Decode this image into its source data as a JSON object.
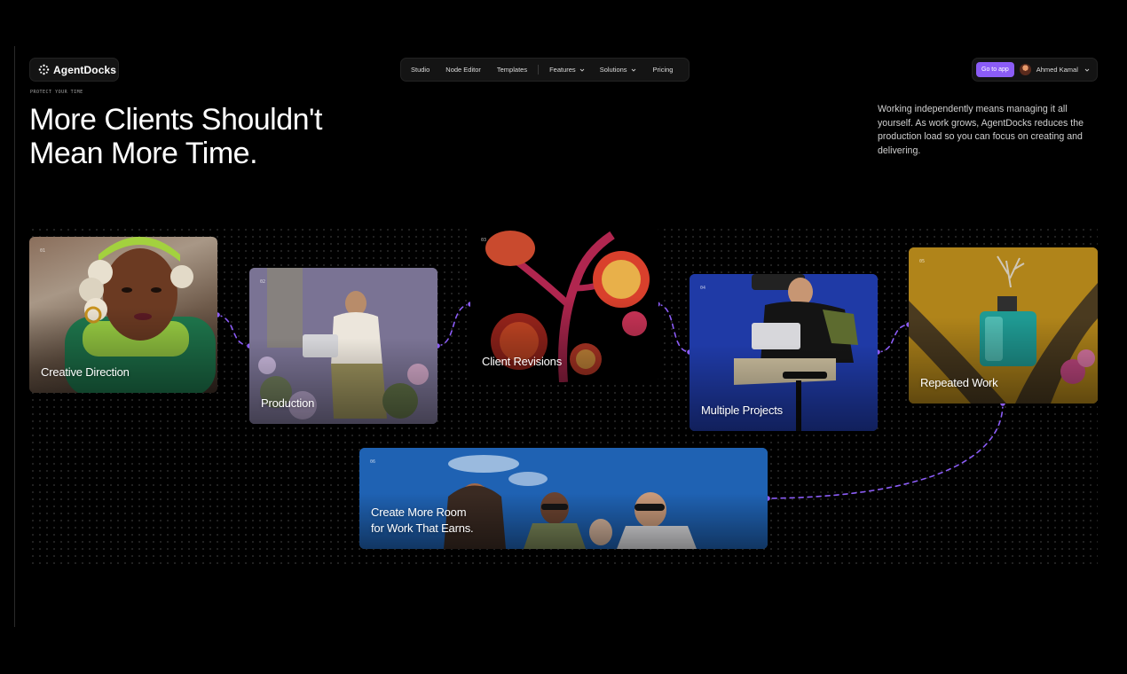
{
  "app": {
    "name": "AgentDocks"
  },
  "nav": {
    "items": [
      {
        "label": "Studio",
        "dropdown": false
      },
      {
        "label": "Node Editor",
        "dropdown": false
      },
      {
        "label": "Templates",
        "dropdown": false
      },
      {
        "label": "Features",
        "dropdown": true
      },
      {
        "label": "Solutions",
        "dropdown": true
      },
      {
        "label": "Pricing",
        "dropdown": false
      }
    ]
  },
  "user": {
    "cta": "Go to app",
    "name": "Ahmed Kamal"
  },
  "hero": {
    "eyebrow": "PROTECT YOUR TIME",
    "title": "More Clients Shouldn't Mean More Time.",
    "description": "Working independently means managing it all yourself. As work grows, AgentDocks reduces the production load so you can focus on creating and delivering."
  },
  "cards": [
    {
      "num": "01",
      "label": "Creative Direction"
    },
    {
      "num": "02",
      "label": "Production"
    },
    {
      "num": "03",
      "label": "Client Revisions"
    },
    {
      "num": "04",
      "label": "Multiple Projects"
    },
    {
      "num": "05",
      "label": "Repeated Work"
    },
    {
      "num": "06",
      "label_line1": "Create More Room",
      "label_line2": "for Work That Earns."
    }
  ],
  "colors": {
    "accent": "#8b5cf6",
    "background": "#000000",
    "wire": "#8b5cf6"
  },
  "icons": {
    "logo": "agentdocks-logo-icon",
    "chevron": "chevron-down-icon"
  }
}
